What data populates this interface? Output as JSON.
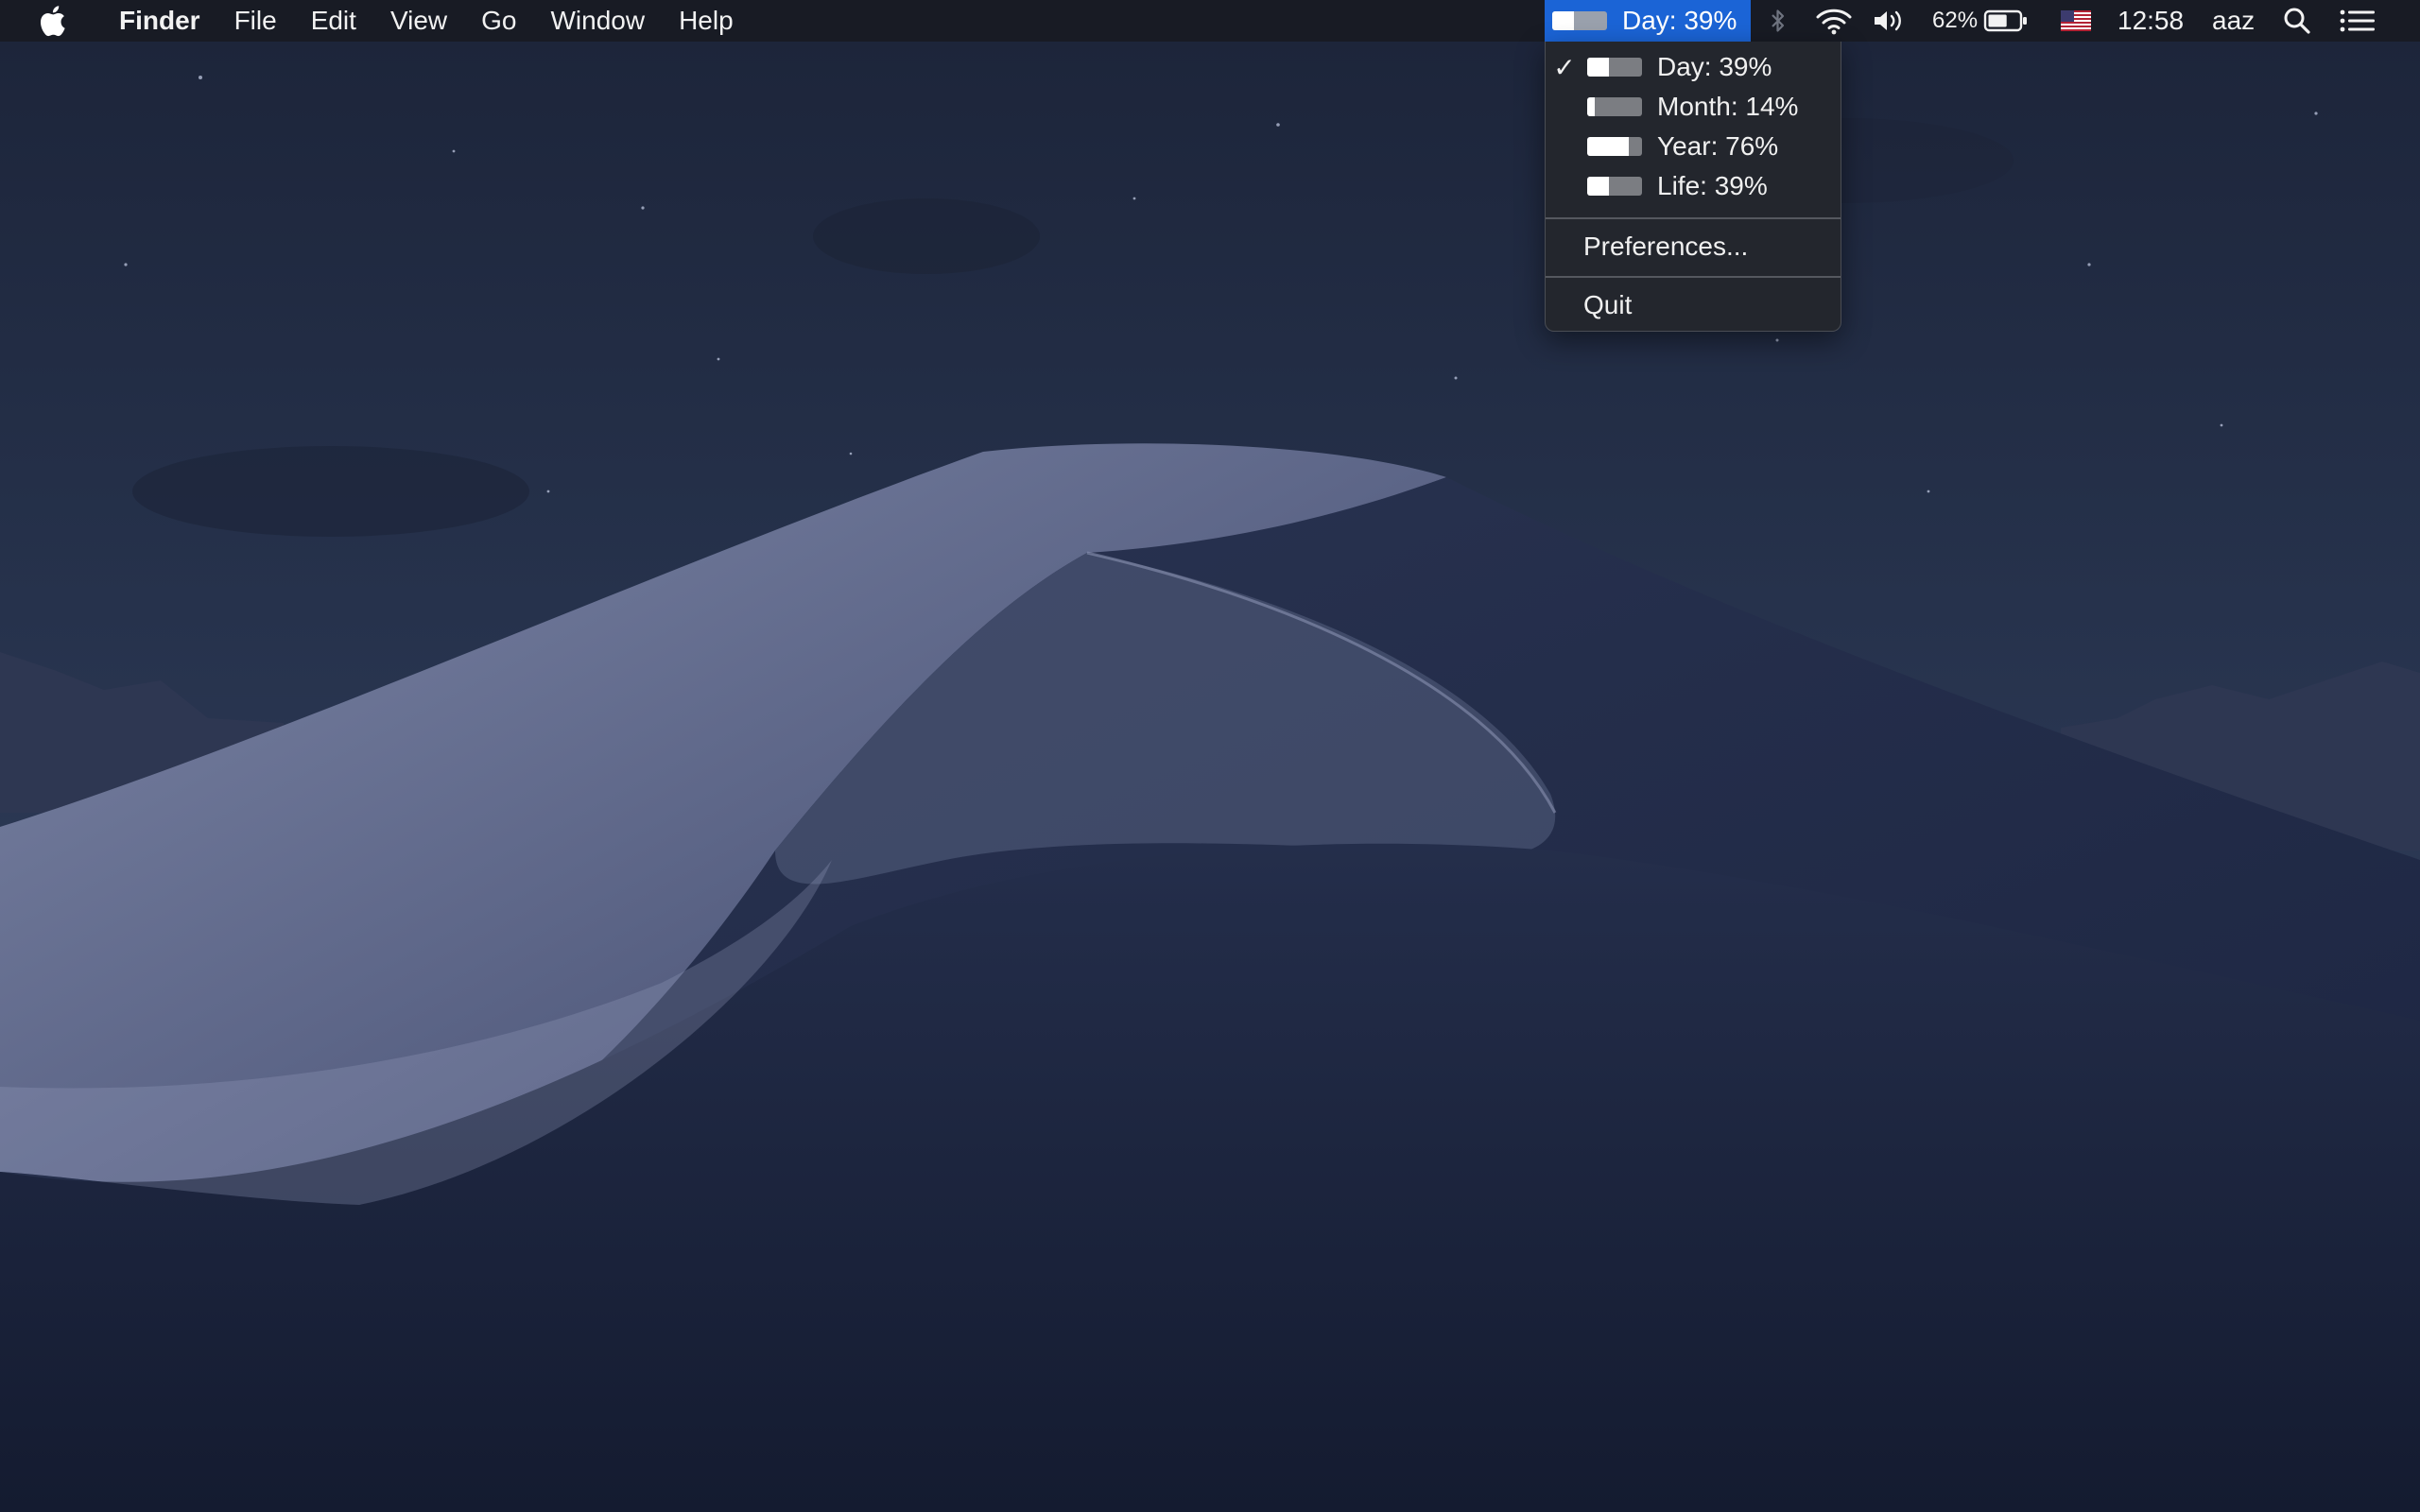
{
  "menubar": {
    "app_name": "Finder",
    "menus": [
      "File",
      "Edit",
      "View",
      "Go",
      "Window",
      "Help"
    ]
  },
  "status_item": {
    "label": "Day: 39%",
    "progress": 0.39
  },
  "tray": {
    "battery_percent": "62%",
    "battery_level": 0.62,
    "time": "12:58",
    "user": "aaz",
    "icons": [
      "bluetooth-icon",
      "wifi-icon",
      "volume-icon",
      "battery-icon",
      "us-flag-icon",
      "spotlight-search-icon",
      "notification-center-icon"
    ]
  },
  "dropdown": {
    "items": [
      {
        "label": "Day: 39%",
        "progress": 0.39,
        "checked": true
      },
      {
        "label": "Month: 14%",
        "progress": 0.14,
        "checked": false
      },
      {
        "label": "Year: 76%",
        "progress": 0.76,
        "checked": false
      },
      {
        "label": "Life: 39%",
        "progress": 0.39,
        "checked": false
      }
    ],
    "checkmark": "✓",
    "preferences_label": "Preferences...",
    "quit_label": "Quit"
  },
  "colors": {
    "menubar_bg": "#181a21",
    "highlight": "#1b64d6",
    "menu_bg": "#24262c",
    "progress_track": "#7b7d82",
    "progress_fill": "#ffffff"
  }
}
